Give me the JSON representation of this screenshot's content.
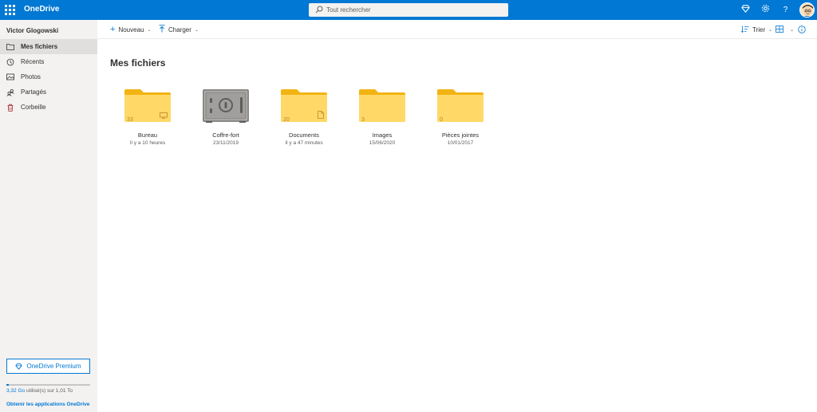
{
  "header": {
    "brand": "OneDrive",
    "search_placeholder": "Tout rechercher",
    "brand_color": "#0078d4"
  },
  "sidebar": {
    "username": "Victor Glogowski",
    "items": [
      {
        "label": "Mes fichiers",
        "icon": "folder-icon",
        "active": true
      },
      {
        "label": "Récents",
        "icon": "recent-icon"
      },
      {
        "label": "Photos",
        "icon": "photo-icon"
      },
      {
        "label": "Partagés",
        "icon": "shared-icon"
      },
      {
        "label": "Corbeille",
        "icon": "recycle-bin-icon"
      }
    ],
    "premium_label": "OneDrive Premium",
    "quota_used": "3,32 Go",
    "quota_rest": " utilisé(s) sur 1,01 To",
    "quota_fraction": 0.003,
    "apps_link": "Obtenir les applications OneDrive"
  },
  "toolbar": {
    "new_label": "Nouveau",
    "upload_label": "Charger",
    "sort_label": "Trier"
  },
  "main": {
    "title": "Mes fichiers",
    "tiles": [
      {
        "name": "Bureau",
        "date": "Il y a 10 heures",
        "count": "33",
        "type": "folder",
        "badge": "desktop-icon"
      },
      {
        "name": "Coffre-fort",
        "date": "23/11/2019",
        "count": "",
        "type": "vault",
        "badge": ""
      },
      {
        "name": "Documents",
        "date": "Il y a 47 minutes",
        "count": "20",
        "type": "folder",
        "badge": "document-icon"
      },
      {
        "name": "Images",
        "date": "15/06/2020",
        "count": "3",
        "type": "folder",
        "badge": ""
      },
      {
        "name": "Pièces jointes",
        "date": "10/01/2017",
        "count": "0",
        "type": "folder",
        "badge": ""
      }
    ]
  }
}
